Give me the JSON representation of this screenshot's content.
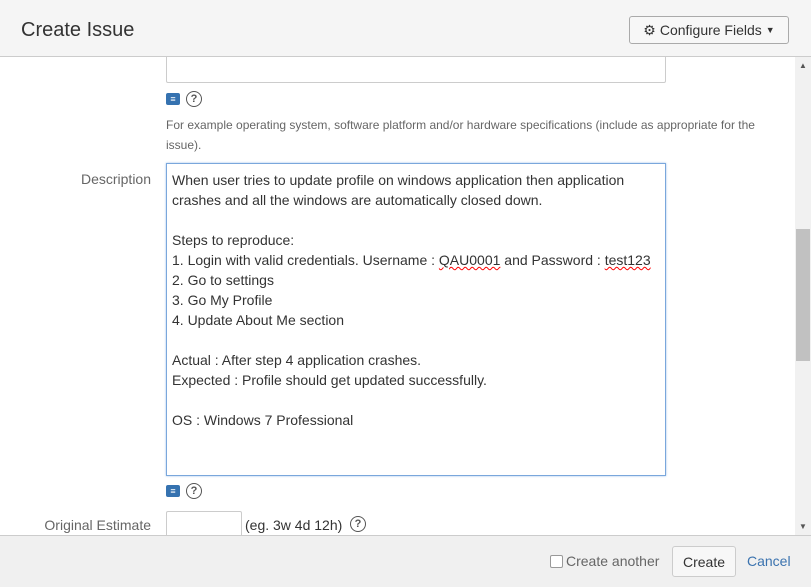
{
  "header": {
    "title": "Create Issue",
    "configure_fields": "Configure Fields"
  },
  "environment": {
    "help_text": "For example operating system, software platform and/or hardware specifications (include as appropriate for the issue)."
  },
  "description": {
    "label": "Description",
    "line1": "When user tries to update profile on windows application then application",
    "line2": "crashes and all the windows are automatically closed down.",
    "line3": "Steps to reproduce:",
    "line4a": "1. Login with valid credentials. Username : ",
    "line4b": "QAU0001",
    "line4c": " and Password : ",
    "line4d": "test123",
    "line5": "2. Go to settings",
    "line6": "3. Go My Profile",
    "line7": "4. Update About Me section",
    "line8": "Actual : After step 4 application crashes.",
    "line9": "Expected : Profile should get updated successfully.",
    "line10": "OS : Windows 7 Professional"
  },
  "original_estimate": {
    "label": "Original Estimate",
    "value": "",
    "hint": "(eg. 3w 4d 12h)"
  },
  "footer": {
    "create_another": "Create another",
    "create": "Create",
    "cancel": "Cancel"
  }
}
